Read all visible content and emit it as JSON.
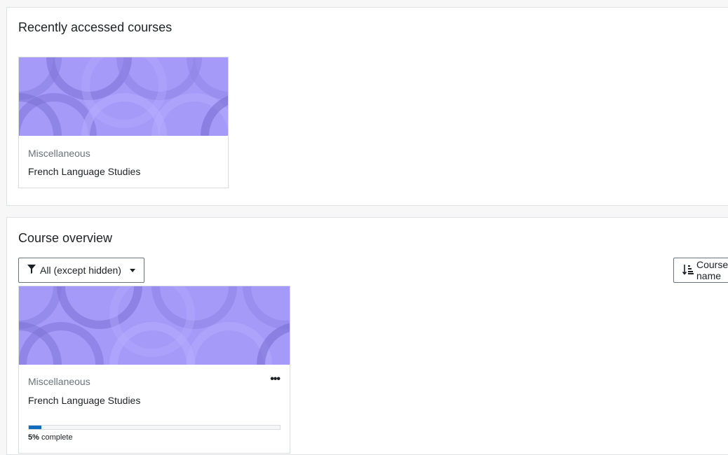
{
  "recent": {
    "title": "Recently accessed courses",
    "course": {
      "category": "Miscellaneous",
      "name": "French Language Studies"
    }
  },
  "overview": {
    "title": "Course overview",
    "filter_label": "All (except hidden)",
    "sort_label": "Course name",
    "course": {
      "category": "Miscellaneous",
      "name": "French Language Studies",
      "progress_percent": 5,
      "progress_value": "5%",
      "progress_suffix": " complete"
    }
  },
  "icons": {
    "filter": "filter-icon",
    "caret": "caret-down-icon",
    "sort": "sort-icon",
    "more": "ellipsis-icon"
  },
  "colors": {
    "course_image_bg": "#a59af7",
    "progress_fill": "#0f6cbf"
  }
}
